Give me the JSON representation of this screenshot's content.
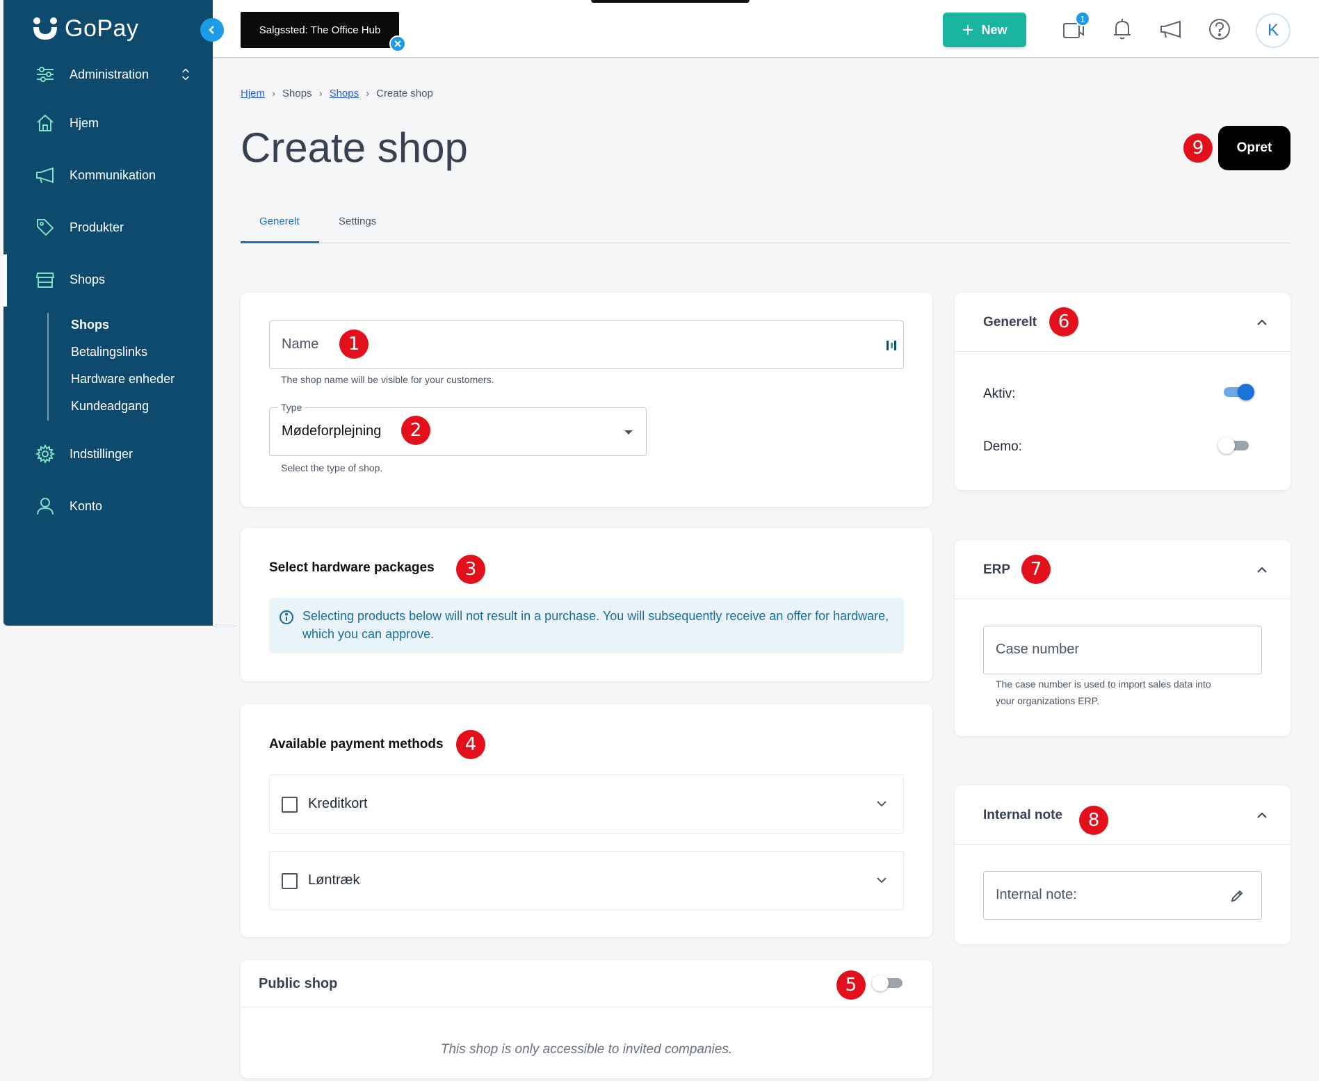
{
  "brand": {
    "name": "GoPay"
  },
  "sidebar": {
    "items": [
      {
        "label": "Administration"
      },
      {
        "label": "Hjem"
      },
      {
        "label": "Kommunikation"
      },
      {
        "label": "Produkter"
      },
      {
        "label": "Shops"
      },
      {
        "label": "Indstillinger"
      },
      {
        "label": "Konto"
      }
    ],
    "sub_items": [
      {
        "label": "Shops"
      },
      {
        "label": "Betalingslinks"
      },
      {
        "label": "Hardware enheder"
      },
      {
        "label": "Kundeadgang"
      }
    ]
  },
  "topbar": {
    "shop_chip": "Salgssted: The Office Hub",
    "new_label": "New",
    "notification_count": "1",
    "avatar_initial": "K"
  },
  "breadcrumb": [
    "Hjem",
    "Shops",
    "Shops",
    "Create shop"
  ],
  "page": {
    "title": "Create shop",
    "submit_label": "Opret"
  },
  "tabs": [
    {
      "label": "Generelt"
    },
    {
      "label": "Settings"
    }
  ],
  "general_form": {
    "name_placeholder": "Name",
    "name_helper": "The shop name will be visible for your customers.",
    "type_label": "Type",
    "type_value": "Mødeforplejning",
    "type_helper": "Select the type of shop."
  },
  "hardware": {
    "title": "Select hardware packages",
    "info": "Selecting products below will not result in a purchase. You will subsequently receive an offer for hardware, which you can approve."
  },
  "payment": {
    "title": "Available payment methods",
    "methods": [
      {
        "label": "Kreditkort"
      },
      {
        "label": "Løntræk"
      }
    ]
  },
  "public_shop": {
    "title": "Public shop",
    "note": "This shop is only accessible to invited companies."
  },
  "generelt_panel": {
    "title": "Generelt",
    "aktiv_label": "Aktiv:",
    "demo_label": "Demo:"
  },
  "erp_panel": {
    "title": "ERP",
    "case_placeholder": "Case number",
    "case_helper_line1": "The case number is used to import sales data into",
    "case_helper_line2": "your organizations ERP."
  },
  "note_panel": {
    "title": "Internal note",
    "note_placeholder": "Internal note:"
  },
  "markers": [
    "1",
    "2",
    "3",
    "4",
    "5",
    "6",
    "7",
    "8",
    "9"
  ],
  "colors": {
    "sidebar": "#0e4a6e",
    "accent_teal": "#1ab5a0",
    "accent_blue": "#1e9be6",
    "marker_red": "#e3101c"
  }
}
